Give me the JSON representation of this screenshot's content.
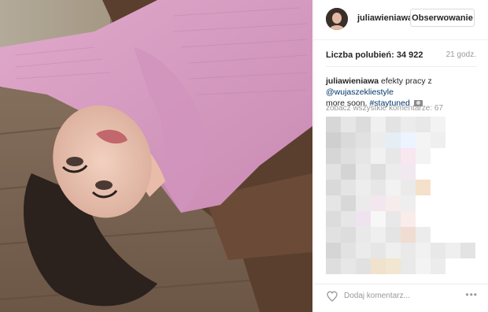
{
  "header": {
    "username": "juliawieniawa",
    "follow_label": "Obserwowanie",
    "avatar": "avatar-image"
  },
  "stats": {
    "likes_text": "Liczba polubień: 34 922",
    "time_text": "21 godz."
  },
  "caption": {
    "author": "juliawieniawa",
    "text_1": " efekty pracy z",
    "mention": "@wujaszekliestyle",
    "text_2": "more soon. ",
    "hashtag": "#staytuned",
    "emoji_icon": "camera-icon"
  },
  "comments": {
    "view_all": "zobacz wszystkie komentarze: 67"
  },
  "footer": {
    "add_comment": "Dodaj komentarz...",
    "more": "•••",
    "like_icon": "heart-icon"
  },
  "colors": {
    "link": "#003569",
    "sweater": "#d79ac1",
    "floor": "#7c6654"
  }
}
